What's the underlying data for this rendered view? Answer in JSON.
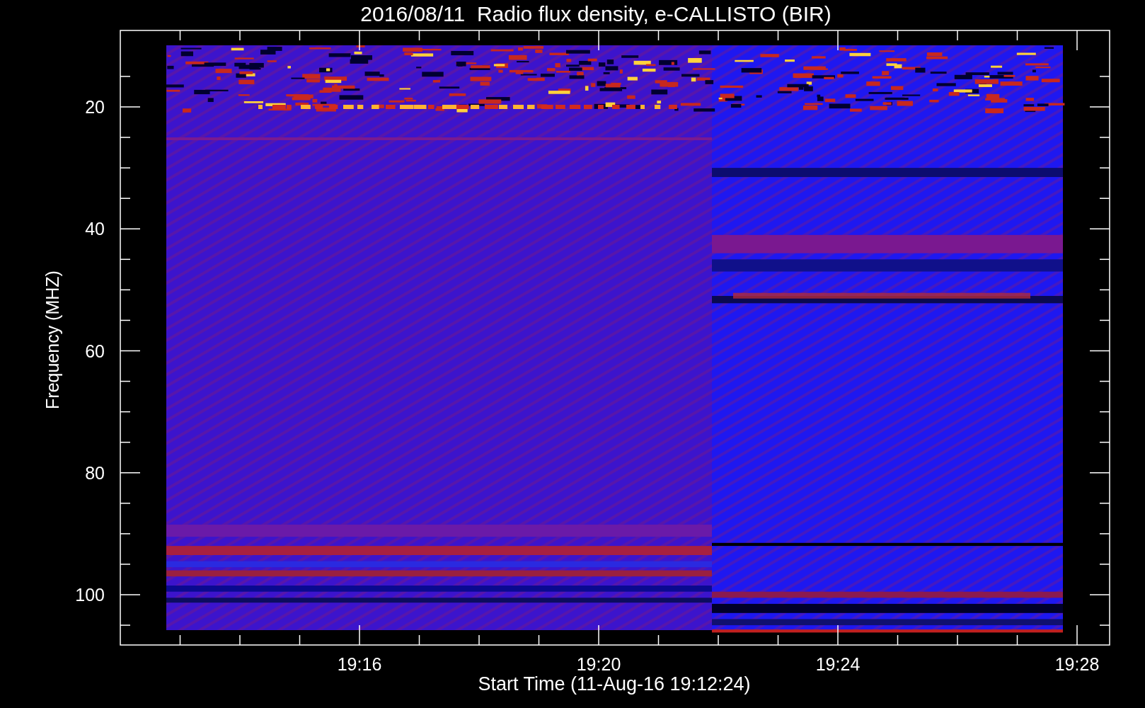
{
  "title": "2016/08/11  Radio flux density, e-CALLISTO (BIR)",
  "y_axis": {
    "label": "Frequency (MHZ)",
    "ticks": [
      "20",
      "40",
      "60",
      "80",
      "100"
    ]
  },
  "x_axis": {
    "label": "Start Time (11-Aug-16 19:12:24)",
    "ticks": [
      "19:16",
      "19:20",
      "19:24",
      "19:28"
    ]
  }
}
